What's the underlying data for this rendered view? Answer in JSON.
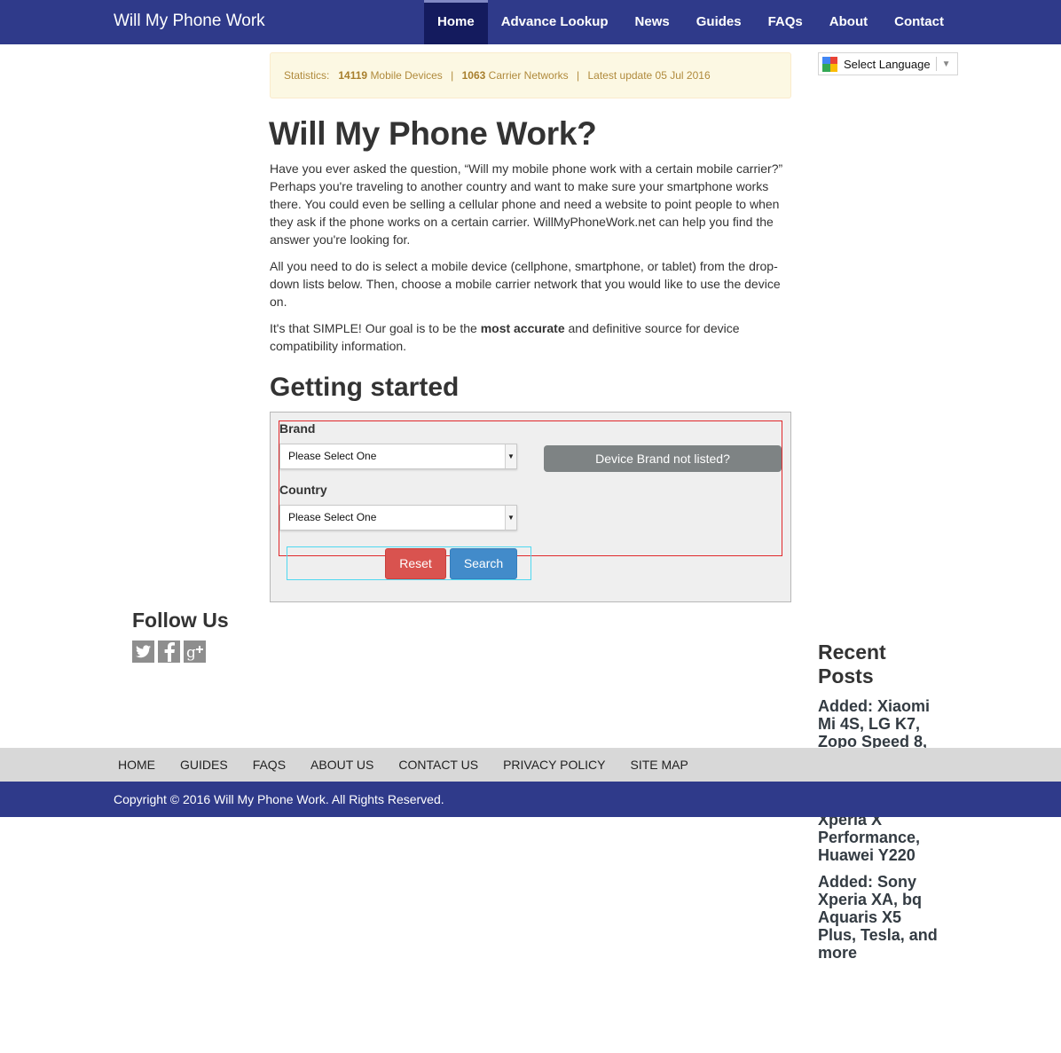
{
  "site": {
    "title": "Will My Phone Work"
  },
  "nav": {
    "items": [
      {
        "label": "Home"
      },
      {
        "label": "Advance Lookup"
      },
      {
        "label": "News"
      },
      {
        "label": "Guides"
      },
      {
        "label": "FAQs"
      },
      {
        "label": "About"
      },
      {
        "label": "Contact"
      }
    ],
    "active": "Home"
  },
  "language": {
    "label": "Select Language",
    "icon": "google-translate-icon"
  },
  "stats": {
    "prefix": "Statistics:",
    "devices_count": "14119",
    "devices_label": "Mobile Devices",
    "separator": "|",
    "carriers_count": "1063",
    "carriers_label": "Carrier Networks",
    "update_label": "Latest update 05 Jul 2016"
  },
  "main": {
    "title": "Will My Phone Work?",
    "p1": "Have you ever asked the question, “Will my mobile phone work with a certain mobile carrier?” Perhaps you're traveling to another country and want to make sure your smartphone works there. You could even be selling a cellular phone and need a website to point people to when they ask if the phone works on a certain carrier. WillMyPhoneWork.net can help you find the answer you're looking for.",
    "p2": "All you need to do is select a mobile device (cellphone, smartphone, or tablet) from the drop-down lists below. Then, choose a mobile carrier network that you would like to use the device on.",
    "p3_before": "It's that SIMPLE! Our goal is to be the ",
    "p3_bold": "most accurate",
    "p3_after": " and definitive source for device compatibility information.",
    "section_title": "Getting started"
  },
  "form": {
    "brand_label": "Brand",
    "brand_value": "Please Select One",
    "country_label": "Country",
    "country_value": "Please Select One",
    "not_listed_button": "Device Brand not listed?",
    "reset_button": "Reset",
    "search_button": "Search"
  },
  "follow": {
    "title": "Follow Us",
    "icons": [
      "twitter-icon",
      "facebook-icon",
      "google-plus-icon"
    ]
  },
  "recent": {
    "title": "Recent Posts",
    "posts": [
      "Added: Xiaomi Mi 4S, LG K7, Zopo Speed 8,",
      "Xperia X Performance, Huawei Y220",
      "Added: Sony Xperia XA, bq Aquaris X5 Plus, Tesla, and more"
    ]
  },
  "footer": {
    "links": [
      "HOME",
      "GUIDES",
      "FAQS",
      "ABOUT US",
      "CONTACT US",
      "PRIVACY POLICY",
      "SITE MAP"
    ],
    "copyright": "Copyright © 2016 Will My Phone Work. All Rights Reserved."
  },
  "colors": {
    "navbar": "#2f3a8a",
    "nav_active": "#141b5e",
    "reset": "#d9534f",
    "search": "#428bca",
    "stats_bg": "#fcf8e3"
  }
}
